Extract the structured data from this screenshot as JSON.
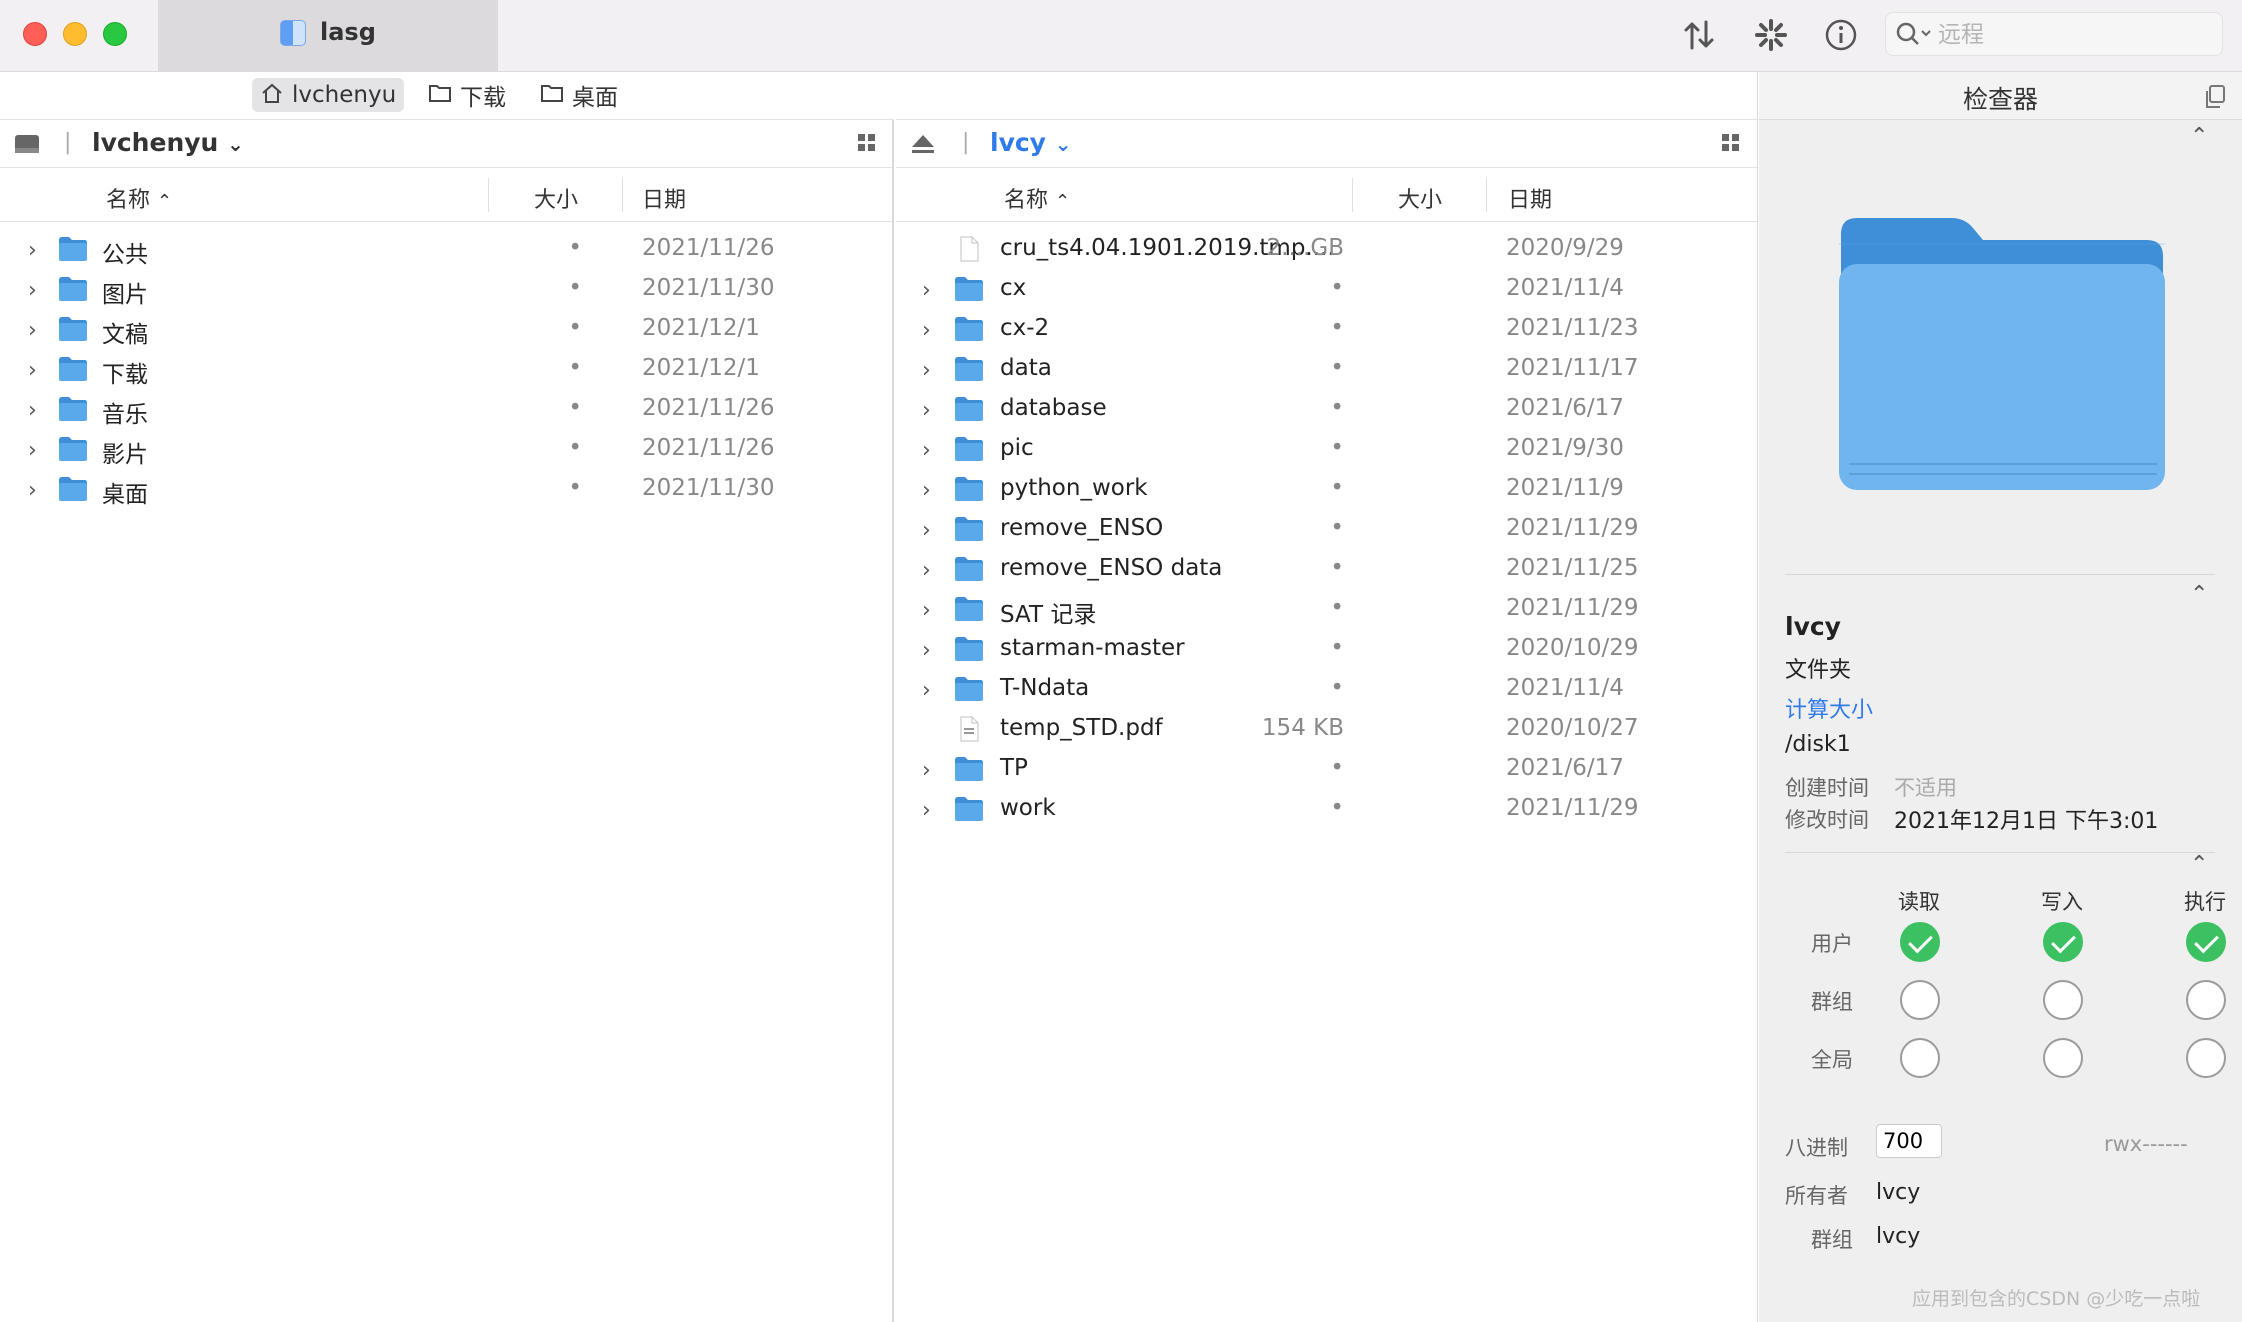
{
  "window": {
    "tab_title": "lasg",
    "search_placeholder": "远程"
  },
  "favorites": [
    {
      "label": "lvchenyu",
      "icon": "home-icon",
      "selected": true
    },
    {
      "label": "下载",
      "icon": "folder-outline-icon",
      "selected": false
    },
    {
      "label": "桌面",
      "icon": "folder-outline-icon",
      "selected": false
    }
  ],
  "columns": {
    "name": "名称",
    "size": "大小",
    "date": "日期"
  },
  "left": {
    "location": "lvchenyu",
    "rows": [
      {
        "name": "公共",
        "size": "•",
        "date": "2021/11/26",
        "type": "folder"
      },
      {
        "name": "图片",
        "size": "•",
        "date": "2021/11/30",
        "type": "folder"
      },
      {
        "name": "文稿",
        "size": "•",
        "date": "2021/12/1",
        "type": "folder"
      },
      {
        "name": "下载",
        "size": "•",
        "date": "2021/12/1",
        "type": "folder"
      },
      {
        "name": "音乐",
        "size": "•",
        "date": "2021/11/26",
        "type": "folder"
      },
      {
        "name": "影片",
        "size": "•",
        "date": "2021/11/26",
        "type": "folder"
      },
      {
        "name": "桌面",
        "size": "•",
        "date": "2021/11/30",
        "type": "folder"
      }
    ]
  },
  "right": {
    "location": "lvcy",
    "rows": [
      {
        "name": "cru_ts4.04.1901.2019.tmp....",
        "size": "2....GB",
        "date": "2020/9/29",
        "type": "file"
      },
      {
        "name": "cx",
        "size": "•",
        "date": "2021/11/4",
        "type": "folder"
      },
      {
        "name": "cx-2",
        "size": "•",
        "date": "2021/11/23",
        "type": "folder"
      },
      {
        "name": "data",
        "size": "•",
        "date": "2021/11/17",
        "type": "folder"
      },
      {
        "name": "database",
        "size": "•",
        "date": "2021/6/17",
        "type": "folder"
      },
      {
        "name": "pic",
        "size": "•",
        "date": "2021/9/30",
        "type": "folder"
      },
      {
        "name": "python_work",
        "size": "•",
        "date": "2021/11/9",
        "type": "folder"
      },
      {
        "name": "remove_ENSO",
        "size": "•",
        "date": "2021/11/29",
        "type": "folder"
      },
      {
        "name": "remove_ENSO data",
        "size": "•",
        "date": "2021/11/25",
        "type": "folder"
      },
      {
        "name": "SAT 记录",
        "size": "•",
        "date": "2021/11/29",
        "type": "folder"
      },
      {
        "name": "starman-master",
        "size": "•",
        "date": "2020/10/29",
        "type": "folder"
      },
      {
        "name": "T-Ndata",
        "size": "•",
        "date": "2021/11/4",
        "type": "folder"
      },
      {
        "name": "temp_STD.pdf",
        "size": "154 KB",
        "date": "2020/10/27",
        "type": "pdf"
      },
      {
        "name": "TP",
        "size": "•",
        "date": "2021/6/17",
        "type": "folder"
      },
      {
        "name": "work",
        "size": "•",
        "date": "2021/11/29",
        "type": "folder"
      }
    ]
  },
  "inspector": {
    "title": "检查器",
    "name": "lvcy",
    "kind": "文件夹",
    "calc_size": "计算大小",
    "path": "/disk1",
    "created_label": "创建时间",
    "created_value": "不适用",
    "modified_label": "修改时间",
    "modified_value": "2021年12月1日 下午3:01",
    "perm_headers": [
      "读取",
      "写入",
      "执行"
    ],
    "perm_rows": [
      {
        "label": "用户",
        "values": [
          true,
          true,
          true
        ]
      },
      {
        "label": "群组",
        "values": [
          false,
          false,
          false
        ]
      },
      {
        "label": "全局",
        "values": [
          false,
          false,
          false
        ]
      }
    ],
    "octal_label": "八进制",
    "octal_value": "700",
    "rwx": "rwx------",
    "owner_label": "所有者",
    "owner_value": "lvcy",
    "group_label": "群组",
    "group_value": "lvcy"
  },
  "watermark": "应用到包含的CSDN @少吃一点啦",
  "colors": {
    "accent": "#2f7bea",
    "folder": "#5aa9ea",
    "check": "#3cc162"
  }
}
